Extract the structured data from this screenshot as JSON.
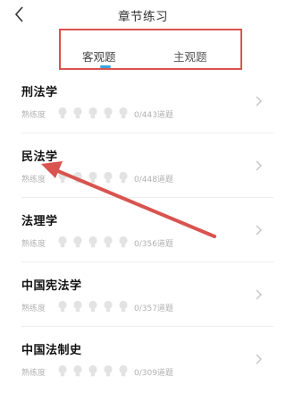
{
  "header": {
    "title": "章节练习"
  },
  "tabs": [
    {
      "label": "客观题",
      "active": true
    },
    {
      "label": "主观题",
      "active": false
    }
  ],
  "chapters": [
    {
      "name": "刑法学",
      "mastery_label": "熟练度",
      "progress": "0/443道题"
    },
    {
      "name": "民法学",
      "mastery_label": "熟练度",
      "progress": "0/448道题"
    },
    {
      "name": "法理学",
      "mastery_label": "熟练度",
      "progress": "0/356道题"
    },
    {
      "name": "中国宪法学",
      "mastery_label": "熟练度",
      "progress": "0/357道题"
    },
    {
      "name": "中国法制史",
      "mastery_label": "熟练度",
      "progress": "0/309道题"
    }
  ],
  "mastery_level": 0,
  "mastery_max": 5,
  "colors": {
    "accent": "#3aa3e0",
    "annotation": "#d9534f",
    "bulb_inactive": "#e3e3e3"
  },
  "icons": {
    "back": "chevron-left-icon",
    "row": "chevron-right-icon",
    "mastery": "lightbulb-icon"
  }
}
